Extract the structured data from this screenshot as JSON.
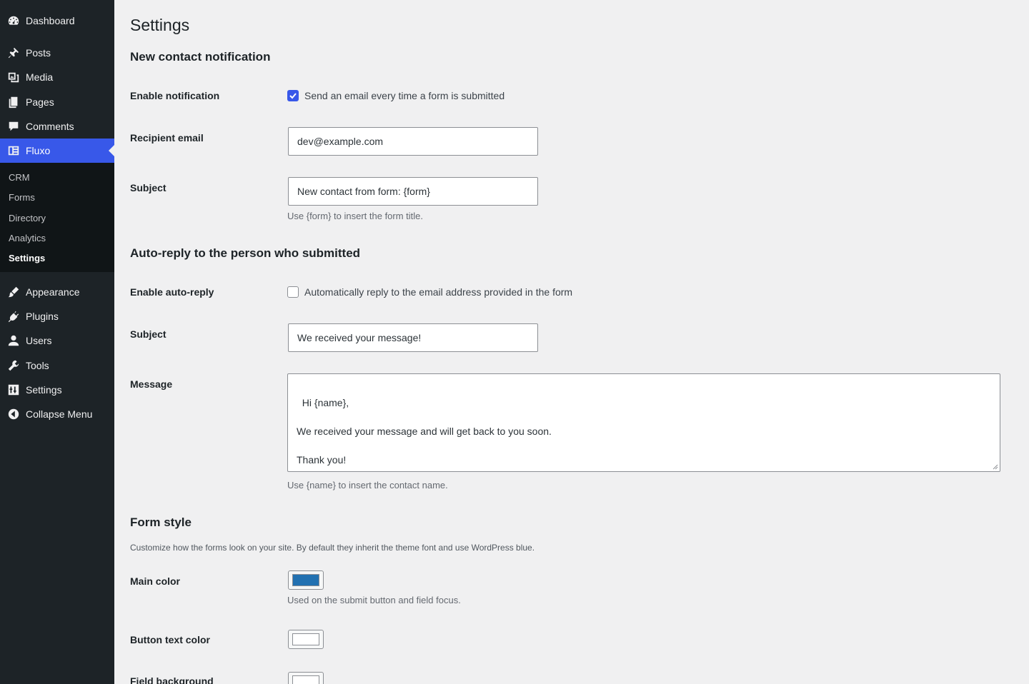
{
  "sidebar": {
    "items": [
      {
        "label": "Dashboard",
        "icon": "dashboard-icon"
      },
      {
        "label": "Posts",
        "icon": "pin-icon"
      },
      {
        "label": "Media",
        "icon": "media-icon"
      },
      {
        "label": "Pages",
        "icon": "pages-icon"
      },
      {
        "label": "Comments",
        "icon": "comment-icon"
      },
      {
        "label": "Fluxo",
        "icon": "fluxo-icon",
        "active": true
      },
      {
        "label": "Appearance",
        "icon": "brush-icon"
      },
      {
        "label": "Plugins",
        "icon": "plugin-icon"
      },
      {
        "label": "Users",
        "icon": "user-icon"
      },
      {
        "label": "Tools",
        "icon": "wrench-icon"
      },
      {
        "label": "Settings",
        "icon": "settings-icon"
      },
      {
        "label": "Collapse Menu",
        "icon": "collapse-icon"
      }
    ],
    "submenu": [
      "CRM",
      "Forms",
      "Directory",
      "Analytics",
      "Settings"
    ]
  },
  "page": {
    "title": "Settings",
    "notification": {
      "heading": "New contact notification",
      "enable_label": "Enable notification",
      "enable_text": "Send an email every time a form is submitted",
      "enable_checked": true,
      "recipient_label": "Recipient email",
      "recipient_value": "dev@example.com",
      "subject_label": "Subject",
      "subject_value": "New contact from form: {form}",
      "subject_help": "Use {form} to insert the form title."
    },
    "autoreply": {
      "heading": "Auto-reply to the person who submitted",
      "enable_label": "Enable auto-reply",
      "enable_text": "Automatically reply to the email address provided in the form",
      "enable_checked": false,
      "subject_label": "Subject",
      "subject_value": "We received your message!",
      "message_label": "Message",
      "message_value": "Hi {name},\n\nWe received your message and will get back to you soon.\n\nThank you!",
      "message_help": "Use {name} to insert the contact name."
    },
    "style": {
      "heading": "Form style",
      "intro": "Customize how the forms look on your site. By default they inherit the theme font and use WordPress blue.",
      "main_color_label": "Main color",
      "main_color": "#2271b1",
      "main_color_help": "Used on the submit button and field focus.",
      "button_text_label": "Button text color",
      "button_text_color": "#ffffff",
      "field_bg_label": "Field background",
      "field_bg_color": "#ffffff"
    }
  },
  "colors": {
    "sidebar_bg": "#1d2327",
    "submenu_bg": "#101517",
    "active_bg": "#3858e9",
    "page_bg": "#f0f0f1"
  }
}
